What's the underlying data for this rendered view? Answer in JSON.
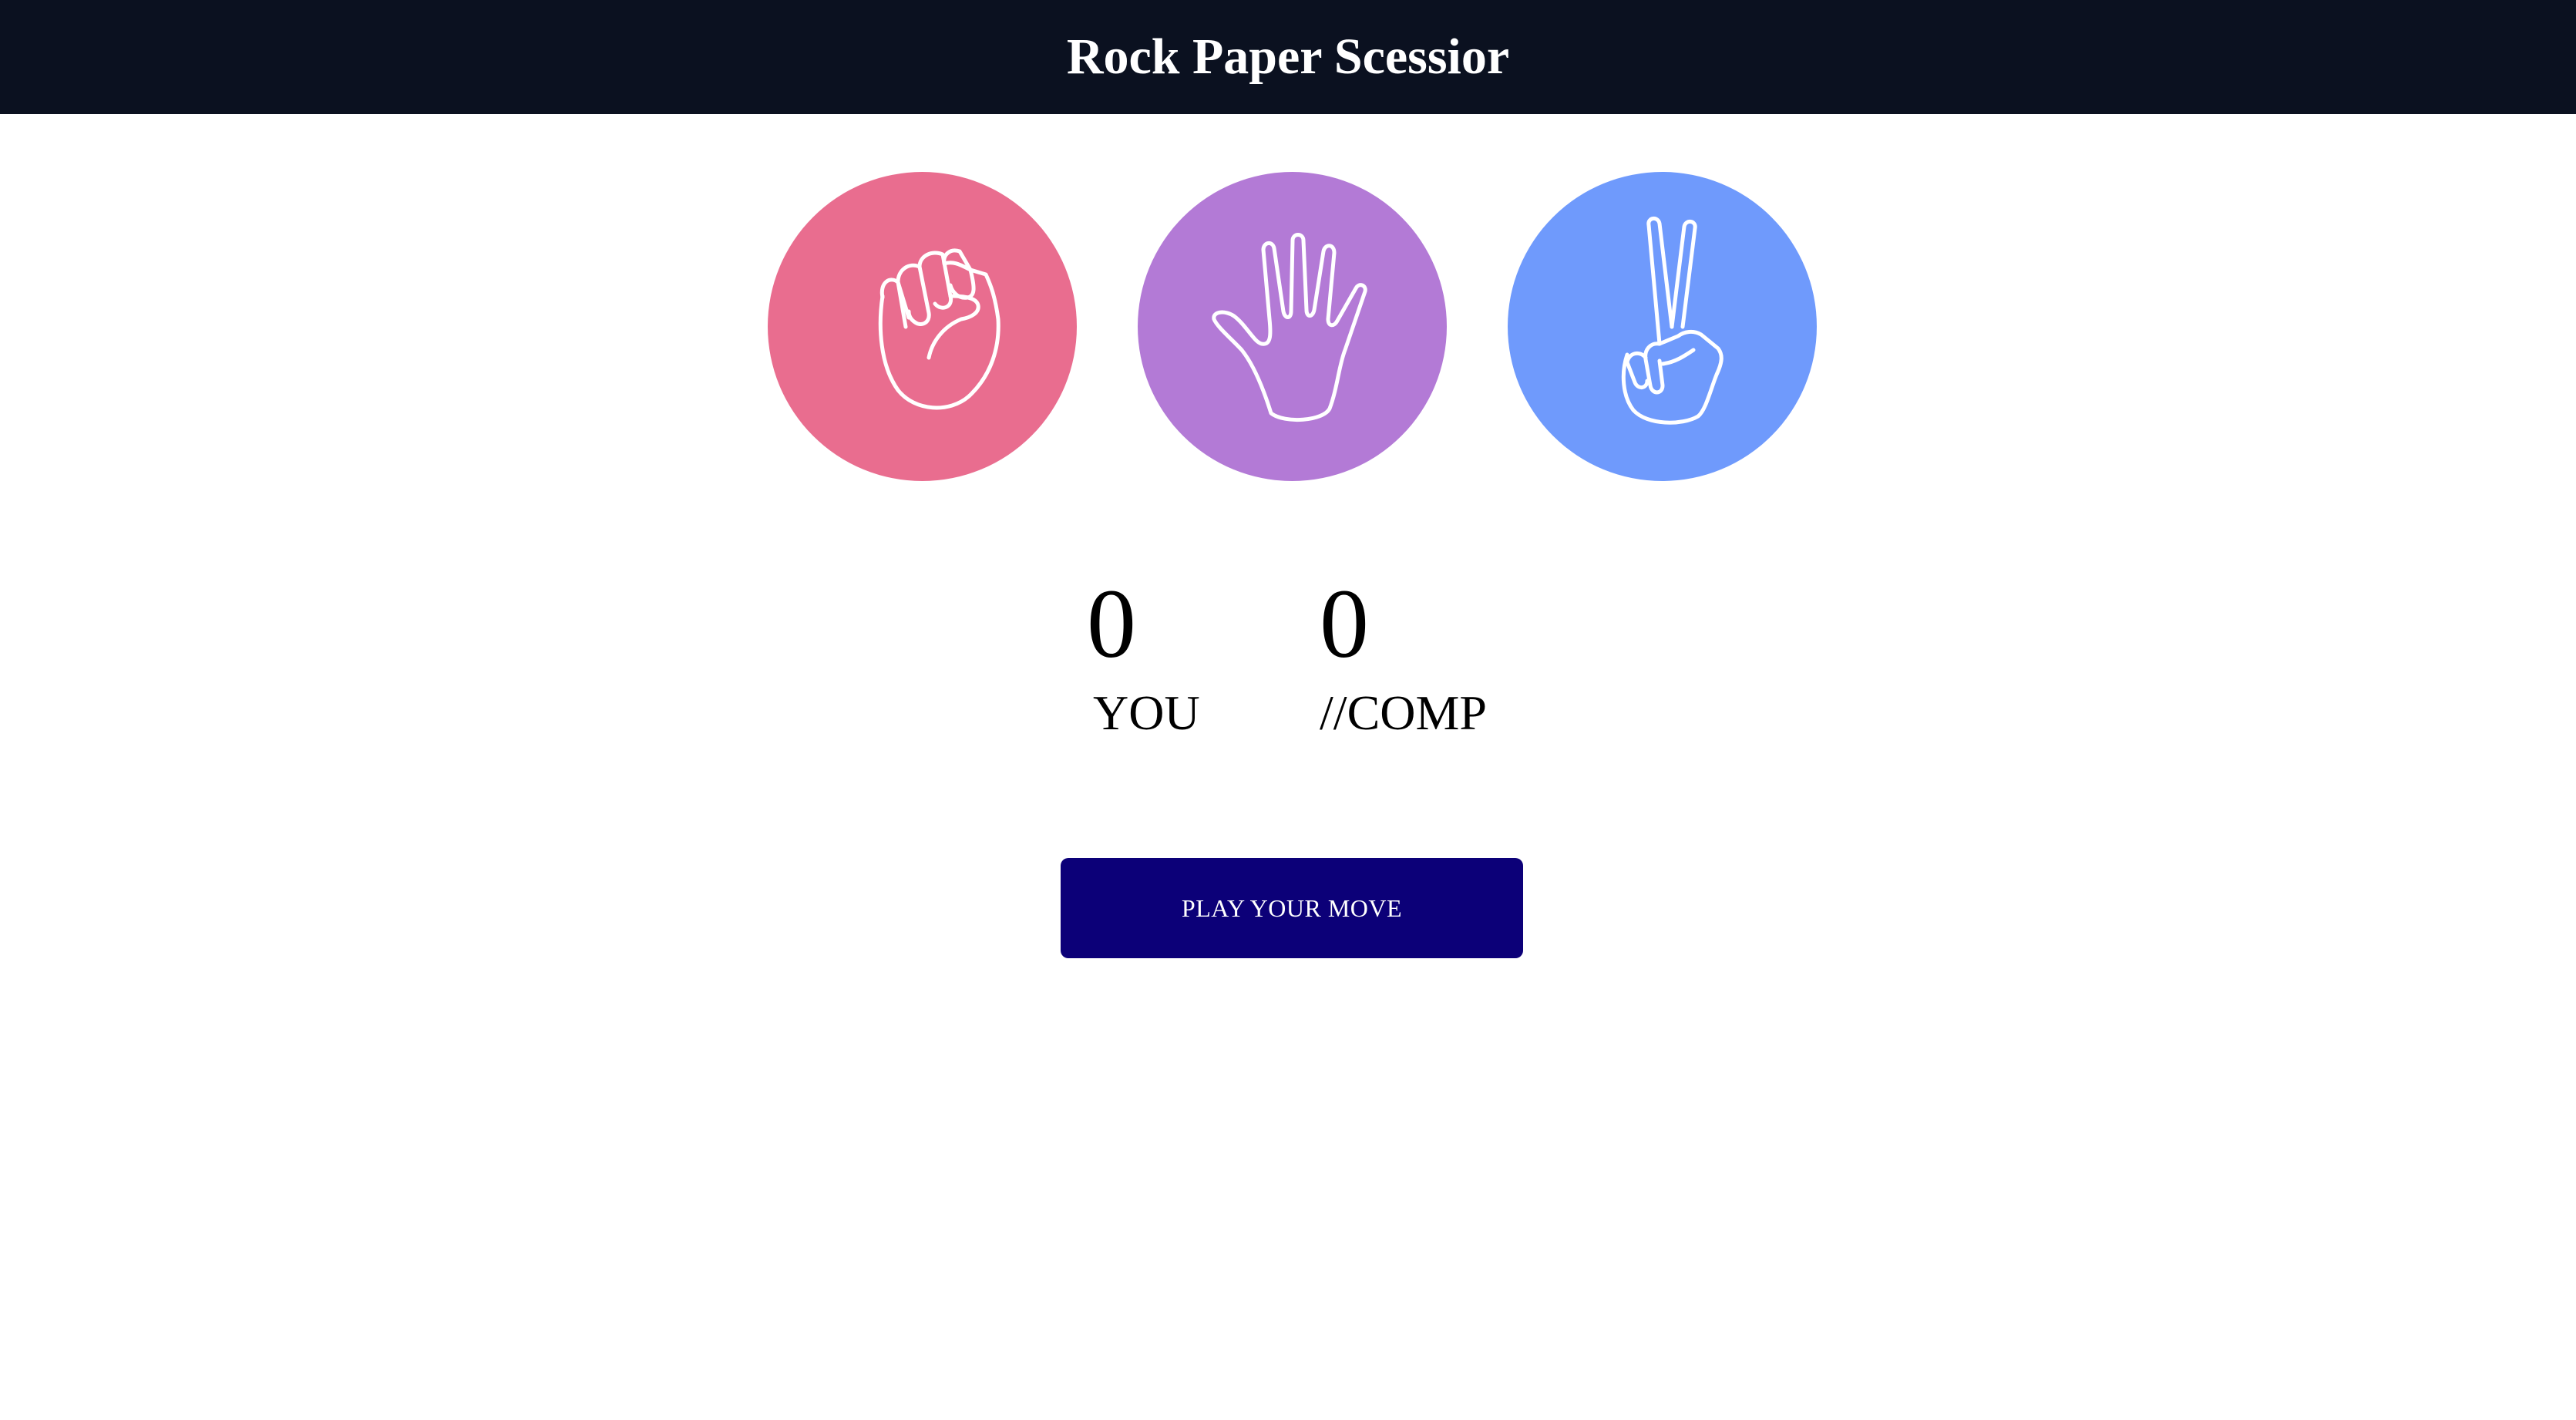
{
  "header": {
    "title": "Rock Paper Scessior"
  },
  "choices": [
    {
      "id": "rock",
      "icon": "fist-icon",
      "color": "#e96d8f"
    },
    {
      "id": "paper",
      "icon": "open-hand-icon",
      "color": "#b37ad6"
    },
    {
      "id": "scissors",
      "icon": "peace-hand-icon",
      "color": "#6f9afc"
    }
  ],
  "scoreboard": {
    "you": {
      "score": "0",
      "label": "YOU"
    },
    "comp": {
      "score": "0",
      "label": "//COMP"
    }
  },
  "play_button": {
    "label": "PLAY YOUR MOVE",
    "color": "#0c0078"
  },
  "theme": {
    "header_bg": "#0b1120",
    "background": "#ffffff"
  }
}
